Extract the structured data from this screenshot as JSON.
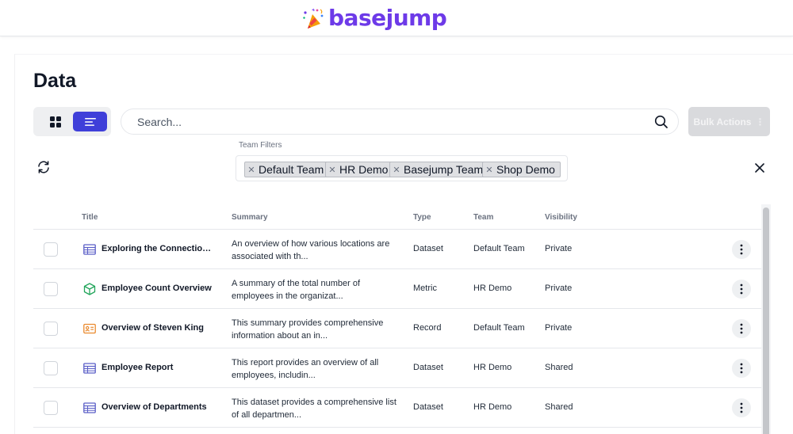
{
  "brand": {
    "name": "basejump"
  },
  "page": {
    "title": "Data"
  },
  "search": {
    "placeholder": "Search..."
  },
  "bulk_actions": {
    "label": "Bulk Actions",
    "dots": "⋮"
  },
  "team_filters": {
    "label": "Team Filters",
    "chips": [
      "Default Team",
      "HR Demo",
      "Basejump Team",
      "Shop Demo"
    ]
  },
  "table": {
    "columns": [
      "Title",
      "Summary",
      "Type",
      "Team",
      "Visibility"
    ],
    "rows": [
      {
        "icon": "table-icon",
        "title": "Exploring the Connection...",
        "summary": "An overview of how various locations are associated with th...",
        "type": "Dataset",
        "team": "Default Team",
        "visibility": "Private"
      },
      {
        "icon": "cube-icon",
        "title": "Employee Count Overview",
        "summary": "A summary of the total number of employees in the organizat...",
        "type": "Metric",
        "team": "HR Demo",
        "visibility": "Private"
      },
      {
        "icon": "id-card-icon",
        "title": "Overview of Steven King",
        "summary": "This summary provides comprehensive information about an in...",
        "type": "Record",
        "team": "Default Team",
        "visibility": "Private"
      },
      {
        "icon": "table-icon",
        "title": "Employee Report",
        "summary": "This report provides an overview of all employees, includin...",
        "type": "Dataset",
        "team": "HR Demo",
        "visibility": "Shared"
      },
      {
        "icon": "table-icon",
        "title": "Overview of Departments",
        "summary": "This dataset provides a comprehensive list of all departmen...",
        "type": "Dataset",
        "team": "HR Demo",
        "visibility": "Shared"
      }
    ]
  },
  "colors": {
    "brand_purple": "#6d3ae8",
    "active_toggle": "#3f3fd9",
    "dataset_icon": "#5b5fc7",
    "metric_icon": "#22a55b",
    "record_icon": "#ea8a2e"
  }
}
